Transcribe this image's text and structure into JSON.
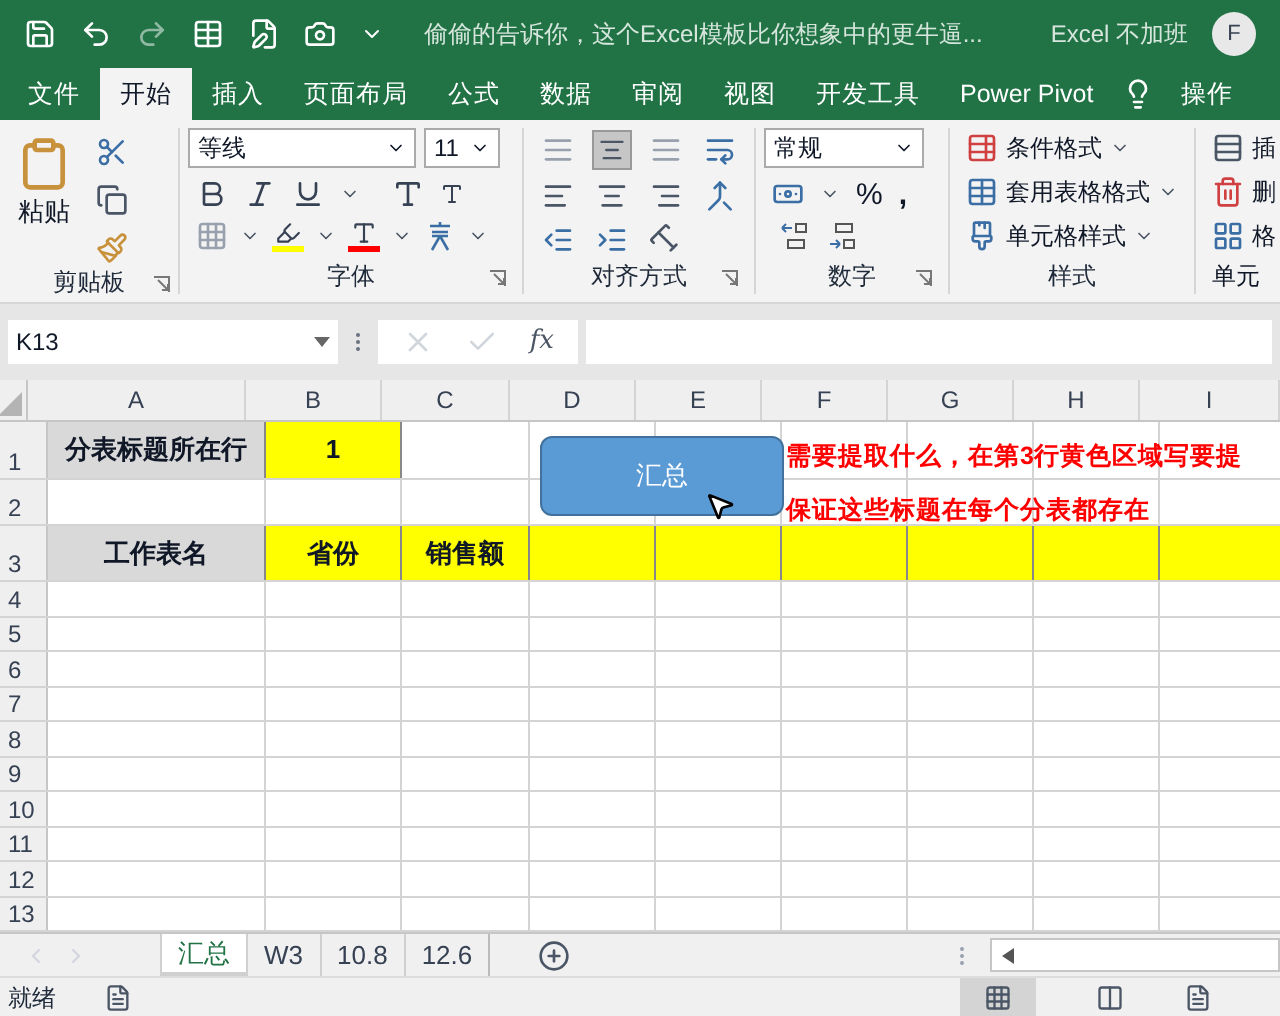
{
  "title_bar": {
    "document_title": "偷偷的告诉你，这个Excel模板比你想象中的更牛逼...",
    "account": "Excel 不加班",
    "avatar": "F"
  },
  "ribbon_tabs": [
    {
      "label": "文件",
      "selected": false
    },
    {
      "label": "开始",
      "selected": true
    },
    {
      "label": "插入",
      "selected": false
    },
    {
      "label": "页面布局",
      "selected": false
    },
    {
      "label": "公式",
      "selected": false
    },
    {
      "label": "数据",
      "selected": false
    },
    {
      "label": "审阅",
      "selected": false
    },
    {
      "label": "视图",
      "selected": false
    },
    {
      "label": "开发工具",
      "selected": false
    },
    {
      "label": "Power Pivot",
      "selected": false
    },
    {
      "label": "操作",
      "selected": false
    }
  ],
  "ribbon": {
    "clipboard": {
      "paste": "粘贴",
      "title": "剪贴板"
    },
    "font": {
      "name": "等线",
      "size": "11",
      "title": "字体"
    },
    "alignment": {
      "title": "对齐方式"
    },
    "number": {
      "format": "常规",
      "percent": "%",
      "comma": ",",
      "title": "数字"
    },
    "styles": {
      "commands": [
        "条件格式",
        "套用表格格式",
        "单元格样式"
      ],
      "title": "样式"
    },
    "cells": {
      "commands": [
        "插",
        "删",
        "格"
      ],
      "title": "单元"
    }
  },
  "formula_bar": {
    "name_box": "K13",
    "function_label": "fx"
  },
  "sheet": {
    "columns": [
      "A",
      "B",
      "C",
      "D",
      "E",
      "F",
      "G",
      "H",
      "I"
    ],
    "rows": [
      {
        "header": "1",
        "cells": [
          {
            "text": "分表标题所在行",
            "color": "#d9d9d9"
          },
          {
            "text": "1",
            "color": "#ffff00"
          }
        ]
      },
      {
        "header": "2"
      },
      {
        "header": "3",
        "cells": [
          {
            "text": "工作表名",
            "color": "#d9d9d9"
          },
          {
            "text": "省份",
            "color": "#ffff00"
          },
          {
            "text": "销售额",
            "color": "#ffff00"
          },
          {
            "color": "#ffff00"
          },
          {
            "color": "#ffff00"
          },
          {
            "color": "#ffff00"
          },
          {
            "color": "#ffff00"
          },
          {
            "color": "#ffff00"
          },
          {
            "color": "#ffff00"
          }
        ]
      },
      {
        "header": "4"
      },
      {
        "header": "5"
      },
      {
        "header": "6"
      },
      {
        "header": "7"
      },
      {
        "header": "8"
      },
      {
        "header": "9"
      },
      {
        "header": "10"
      },
      {
        "header": "11"
      },
      {
        "header": "12"
      },
      {
        "header": "13"
      }
    ]
  },
  "shape_button": {
    "label": "汇总"
  },
  "notes": [
    "需要提取什么，在第3行黄色区域写要提",
    "保证这些标题在每个分表都存在"
  ],
  "sheet_tabs": [
    {
      "label": "汇总",
      "selected": true
    },
    {
      "label": "W3",
      "selected": false
    },
    {
      "label": "10.8",
      "selected": false
    },
    {
      "label": "12.6",
      "selected": false
    }
  ],
  "status_bar": {
    "status": "就绪"
  }
}
